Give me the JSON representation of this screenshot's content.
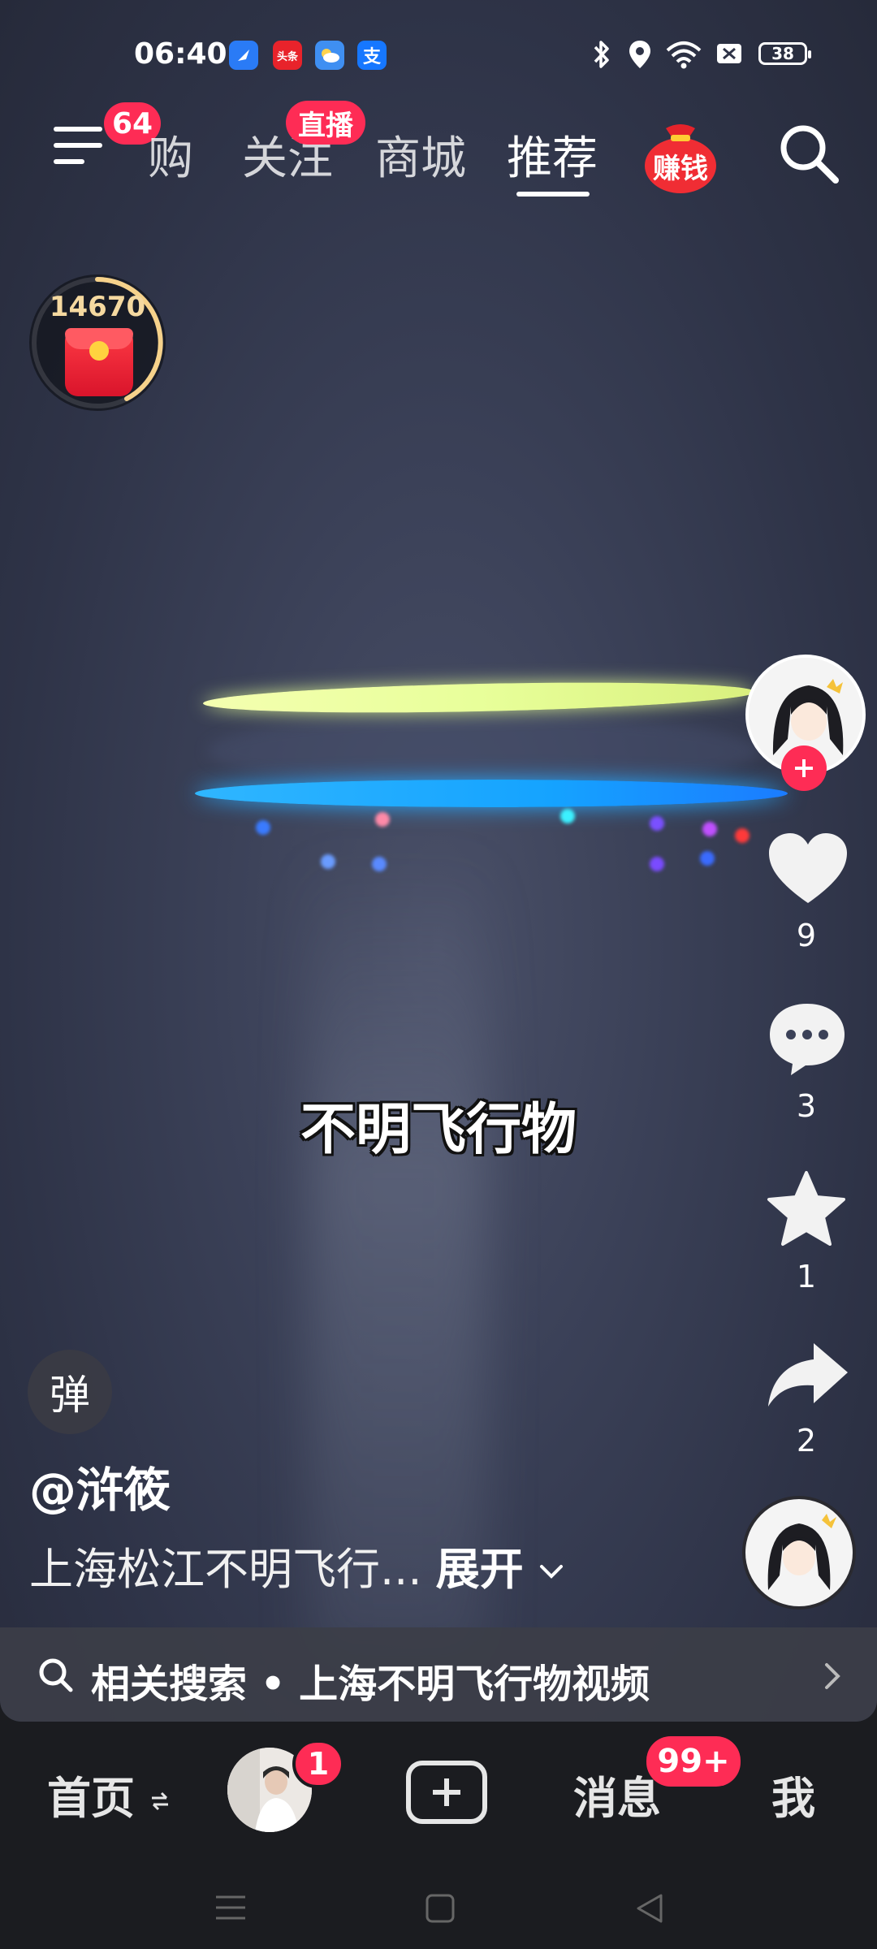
{
  "status_bar": {
    "time": "06:40",
    "apps": [
      "头条",
      "支"
    ],
    "battery": "38"
  },
  "top_nav": {
    "menu_badge": "64",
    "tabs": [
      {
        "label": "购"
      },
      {
        "label": "关注",
        "badge": "直播"
      },
      {
        "label": "商城"
      },
      {
        "label": "推荐"
      }
    ],
    "earn_label": "赚钱"
  },
  "coin_counter": {
    "value": "14670"
  },
  "video": {
    "caption": "不明飞行物"
  },
  "right_rail": {
    "likes": "9",
    "comments": "3",
    "favorites": "1",
    "shares": "2"
  },
  "danmu_label": "弹",
  "author": "@浒筱",
  "description": "上海松江不明飞行...",
  "expand_label": "展开",
  "related_search": {
    "prefix": "相关搜索",
    "query": "上海不明飞行物视频"
  },
  "bottom_nav": {
    "home": "首页",
    "friends_badge": "1",
    "messages": "消息",
    "messages_badge": "99+",
    "me": "我"
  },
  "colors": {
    "accent": "#fe2c55",
    "ufo_top_ring": "#e8ff9a",
    "ufo_bottom_ring": "#15a3ff"
  }
}
